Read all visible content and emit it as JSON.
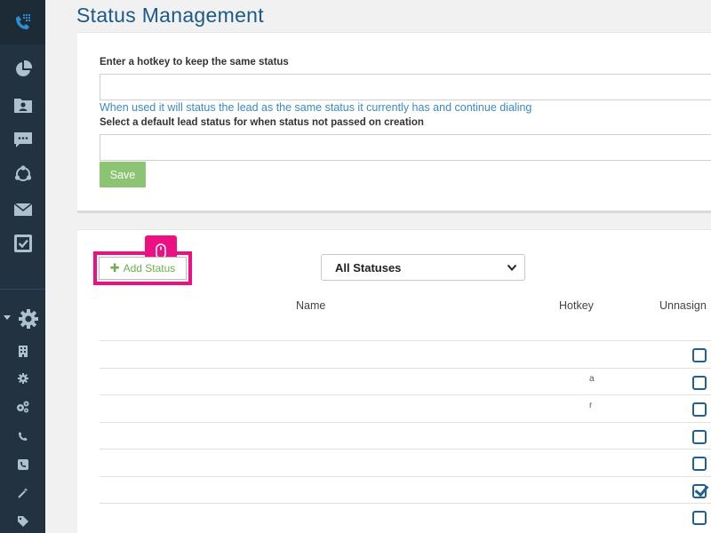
{
  "page": {
    "title": "Status Management"
  },
  "sidebar": {
    "top_icons": [
      "phone-grid-icon",
      "pie-chart-icon",
      "contact-folder-icon",
      "chat-icon",
      "network-icon",
      "mail-icon",
      "calendar-check-icon"
    ],
    "bottom_icons": [
      "settings-gear-icon",
      "building-icon",
      "small-gear-icon",
      "cogs-icon",
      "phone-icon",
      "phone-square-icon",
      "magic-wand-icon",
      "tag-icon"
    ]
  },
  "settings_form": {
    "hotkey_label": "Enter a hotkey to keep the same status",
    "hotkey_value": "",
    "hotkey_help": "When used it will status the lead as the same status it currently has and continue dialing",
    "default_status_label": "Select a default lead status for when status not passed on creation",
    "default_status_value": "",
    "save_label": "Save"
  },
  "status_table": {
    "add_label": "Add Status",
    "filter": {
      "selected": "All Statuses"
    },
    "columns": {
      "name": "Name",
      "hotkey": "Hotkey",
      "unassign": "Unnasign"
    },
    "rows": [
      {
        "name": "",
        "hotkey": "",
        "unassign": false
      },
      {
        "name": "",
        "hotkey": "a",
        "unassign": false
      },
      {
        "name": "",
        "hotkey": "r",
        "unassign": false
      },
      {
        "name": "",
        "hotkey": "",
        "unassign": false
      },
      {
        "name": "",
        "hotkey": "",
        "unassign": false
      },
      {
        "name": "",
        "hotkey": "",
        "unassign": true
      },
      {
        "name": "",
        "hotkey": "",
        "unassign": false
      }
    ]
  },
  "colors": {
    "brand": "#1c5a8a",
    "sidebar": "#223240",
    "save": "#8cc474",
    "highlight": "#ee0f82"
  }
}
